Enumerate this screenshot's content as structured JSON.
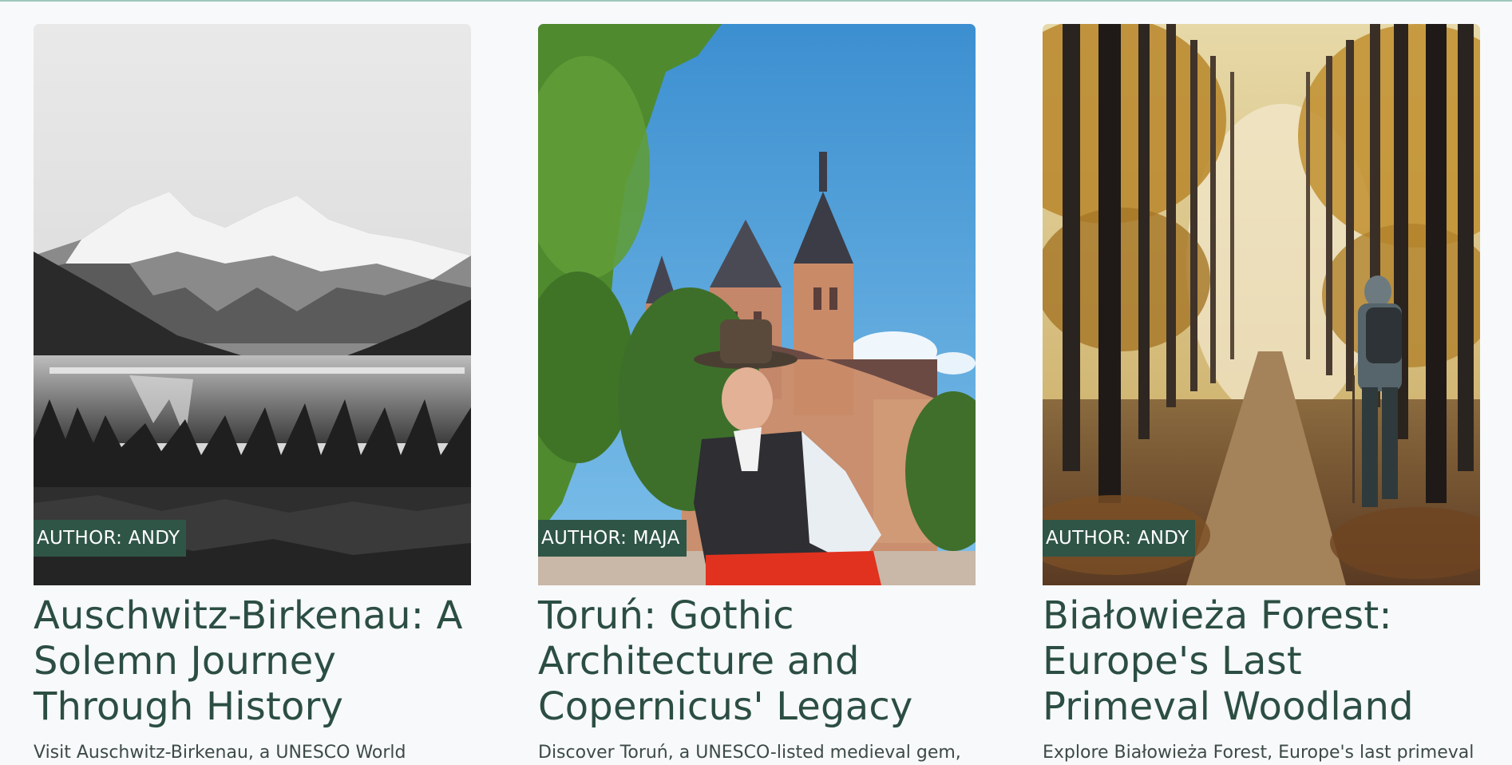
{
  "cards": [
    {
      "image": "black-and-white mountain lake with snowy peaks and forest",
      "author_label": "AUTHOR: ANDY",
      "title": "Auschwitz-Birkenau: A Solemn Journey Through History",
      "description": "Visit Auschwitz-Birkenau, a UNESCO World"
    },
    {
      "image": "man in traditional clothing in front of gothic church towers",
      "author_label": "AUTHOR: MAJA",
      "title": "Toruń: Gothic Architecture and Copernicus' Legacy",
      "description": "Discover Toruń, a UNESCO-listed medieval gem,"
    },
    {
      "image": "hiker walking along an autumn forest path",
      "author_label": "AUTHOR: ANDY",
      "title": "Białowieża Forest: Europe's Last Primeval Woodland",
      "description": "Explore Białowieża Forest, Europe's last primeval"
    }
  ],
  "colors": {
    "author_badge": "#2f5546",
    "title": "#2c4e42",
    "background": "#f7f9fb"
  }
}
